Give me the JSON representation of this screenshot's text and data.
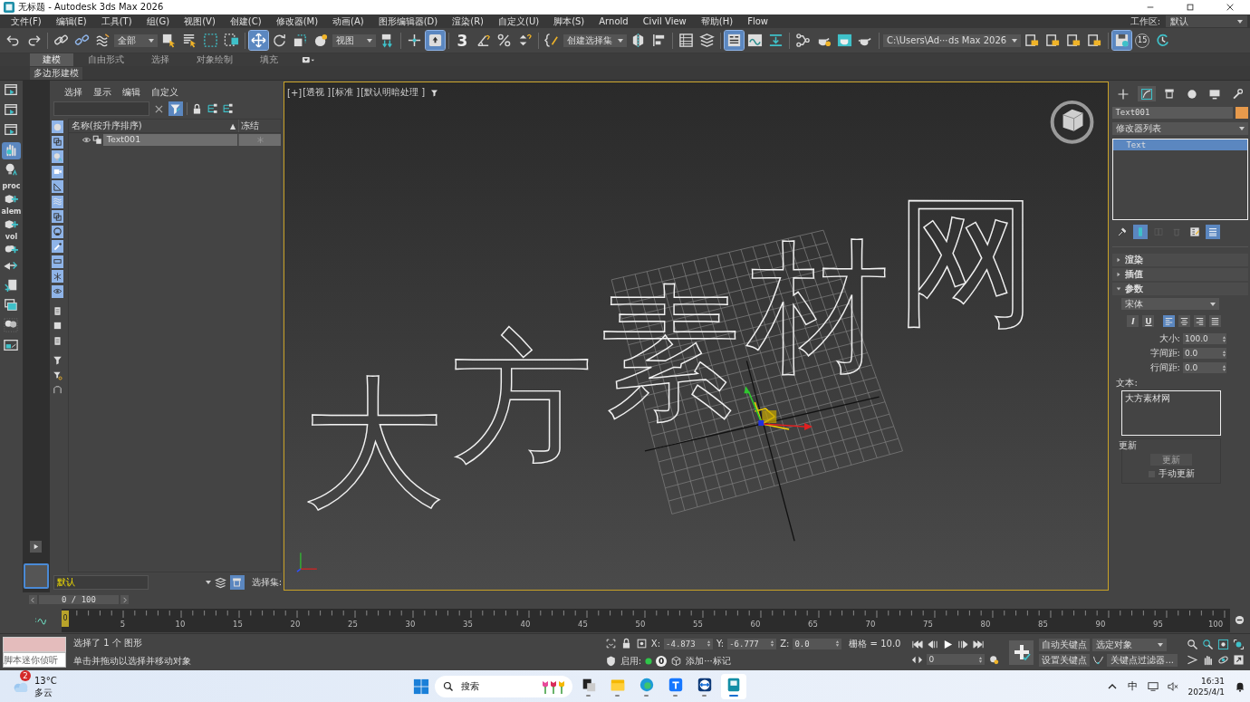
{
  "window": {
    "title": "无标题 - Autodesk 3ds Max 2026"
  },
  "menu": [
    "文件(F)",
    "编辑(E)",
    "工具(T)",
    "组(G)",
    "视图(V)",
    "创建(C)",
    "修改器(M)",
    "动画(A)",
    "图形编辑器(D)",
    "渲染(R)",
    "自定义(U)",
    "脚本(S)",
    "Arnold",
    "Civil View",
    "帮助(H)",
    "Flow"
  ],
  "workspace": {
    "label": "工作区:",
    "value": "默认"
  },
  "toolbar": [
    {
      "kind": "button",
      "selected": false
    },
    {
      "kind": "button",
      "selected": false
    },
    {
      "kind": "separator"
    },
    {
      "kind": "button",
      "selected": false
    },
    {
      "kind": "button",
      "selected": false
    },
    {
      "kind": "button",
      "selected": false
    },
    {
      "kind": "dropdown",
      "value": "全部"
    },
    {
      "kind": "button",
      "selected": false
    },
    {
      "kind": "button",
      "selected": false
    },
    {
      "kind": "button",
      "selected": false
    },
    {
      "kind": "button",
      "selected": false
    },
    {
      "kind": "separator"
    },
    {
      "kind": "button",
      "selected": true
    },
    {
      "kind": "button",
      "selected": false
    },
    {
      "kind": "button",
      "selected": false
    },
    {
      "kind": "button",
      "selected": false
    },
    {
      "kind": "dropdown",
      "value": "视图"
    },
    {
      "kind": "button",
      "selected": false
    },
    {
      "kind": "separator"
    },
    {
      "kind": "button",
      "selected": false
    },
    {
      "kind": "button",
      "selected": true
    },
    {
      "kind": "separator"
    },
    {
      "kind": "button",
      "selected": false,
      "label": "3"
    },
    {
      "kind": "button",
      "selected": false
    },
    {
      "kind": "button",
      "selected": false
    },
    {
      "kind": "button",
      "selected": false
    },
    {
      "kind": "separator"
    },
    {
      "kind": "button",
      "selected": false
    },
    {
      "kind": "dropdown",
      "value": "创建选择集"
    },
    {
      "kind": "button",
      "selected": false
    },
    {
      "kind": "button",
      "selected": false
    },
    {
      "kind": "separator"
    },
    {
      "kind": "button",
      "selected": false
    },
    {
      "kind": "button",
      "selected": false
    },
    {
      "kind": "separator"
    },
    {
      "kind": "button",
      "selected": true
    },
    {
      "kind": "button",
      "selected": false
    },
    {
      "kind": "button",
      "selected": false
    },
    {
      "kind": "separator"
    },
    {
      "kind": "button",
      "selected": false
    },
    {
      "kind": "button",
      "selected": false
    },
    {
      "kind": "button",
      "selected": false
    },
    {
      "kind": "button",
      "selected": false
    },
    {
      "kind": "separator"
    },
    {
      "kind": "dropdown",
      "value": "C:\\Users\\Ad⋯ds Max 2026"
    },
    {
      "kind": "button",
      "selected": false
    },
    {
      "kind": "button",
      "selected": false
    },
    {
      "kind": "button",
      "selected": false
    },
    {
      "kind": "button",
      "selected": false
    },
    {
      "kind": "separator"
    },
    {
      "kind": "button",
      "selected": true
    },
    {
      "kind": "button",
      "selected": false,
      "label": "15"
    },
    {
      "kind": "button",
      "selected": false
    }
  ],
  "ribbon": {
    "tabs": [
      {
        "label": "建模",
        "selected": true
      },
      {
        "label": "自由形式",
        "selected": false
      },
      {
        "label": "选择",
        "selected": false
      },
      {
        "label": "对象绘制",
        "selected": false
      },
      {
        "label": "填充",
        "selected": false
      }
    ],
    "panel": "多边形建模"
  },
  "left_toolbar": [
    {
      "selected": false
    },
    {
      "selected": false
    },
    {
      "selected": false
    },
    {
      "selected": true
    },
    {
      "selected": false
    },
    {
      "selected": false,
      "label": "proc"
    },
    {
      "selected": false,
      "label": "alem"
    },
    {
      "selected": false,
      "label": "vol"
    },
    {
      "selected": false
    },
    {
      "selected": false
    },
    {
      "selected": false
    },
    {
      "selected": false
    },
    {
      "selected": false
    }
  ],
  "explorer": {
    "menu": [
      "选择",
      "显示",
      "编辑",
      "自定义"
    ],
    "filter_on": true,
    "columns": [
      "名称(按升序排序)",
      "冻结"
    ],
    "sort_indicator": "▲",
    "rows": [
      {
        "name": "Text001",
        "selected": true
      }
    ],
    "filters": [
      {
        "selected": true
      },
      {
        "selected": true
      },
      {
        "selected": true
      },
      {
        "selected": true
      },
      {
        "selected": true
      },
      {
        "selected": true
      },
      {
        "selected": true
      },
      {
        "selected": true
      },
      {
        "selected": true
      },
      {
        "selected": true
      },
      {
        "selected": true
      },
      {
        "selected": true
      },
      {
        "selected": false
      },
      {
        "selected": false
      },
      {
        "selected": false
      },
      {
        "selected": false
      },
      {
        "selected": false
      },
      {
        "selected": false
      }
    ],
    "layer": "默认",
    "selection_set_label": "选择集:"
  },
  "viewport": {
    "labels": [
      "[+]",
      "[透视 ]",
      "[标准 ]",
      "[默认明暗处理 ]"
    ],
    "scene_text": "大方素材网",
    "active": true
  },
  "command_panel": {
    "tabs": [
      {
        "selected": false
      },
      {
        "selected": true
      },
      {
        "selected": false
      },
      {
        "selected": false
      },
      {
        "selected": false
      },
      {
        "selected": false
      }
    ],
    "object_name": "Text001",
    "modifier_list": "修改器列表",
    "stack": [
      {
        "name": "Text",
        "selected": true
      }
    ],
    "stack_tools": [
      {
        "selected": false,
        "disabled": false
      },
      {
        "selected": true,
        "disabled": false
      },
      {
        "selected": false,
        "disabled": true
      },
      {
        "selected": false,
        "disabled": true
      },
      {
        "selected": false,
        "disabled": false
      },
      {
        "selected": true,
        "disabled": false
      }
    ],
    "rollouts": [
      {
        "title": "渲染",
        "expanded": false
      },
      {
        "title": "插值",
        "expanded": false
      },
      {
        "title": "参数",
        "expanded": true
      }
    ],
    "parameters": {
      "font": "宋体",
      "styles": [
        {
          "label": "I",
          "selected": false
        },
        {
          "label": "U",
          "selected": false
        }
      ],
      "align": [
        {
          "selected": true
        },
        {
          "selected": false
        },
        {
          "selected": false
        },
        {
          "selected": false
        }
      ],
      "fields": [
        {
          "label": "大小:",
          "value": "100.0"
        },
        {
          "label": "字间距:",
          "value": "0.0"
        },
        {
          "label": "行间距:",
          "value": "0.0"
        }
      ],
      "text_label": "文本:",
      "text": "大方素材网",
      "update_group": "更新",
      "update_button": {
        "label": "更新",
        "disabled": true
      },
      "manual_update": {
        "label": "手动更新",
        "checked": false
      }
    }
  },
  "timeline": {
    "position": "0 / 100",
    "thumb": "0",
    "labels": [
      "5",
      "10",
      "15",
      "20",
      "25",
      "30",
      "35",
      "40",
      "45",
      "50",
      "55",
      "60",
      "65",
      "70",
      "75",
      "80",
      "85",
      "90",
      "95",
      "100"
    ]
  },
  "status": {
    "listener": "脚本迷你侦听",
    "selection": "选择了 1 个 图形",
    "prompt": "单击并拖动以选择并移动对象",
    "coords": [
      {
        "label": "X:",
        "value": "-4.873"
      },
      {
        "label": "Y:",
        "value": "-6.777"
      },
      {
        "label": "Z:",
        "value": "0.0"
      }
    ],
    "grid": "栅格 = 10.0",
    "enable_label": "启用:",
    "counter": "0",
    "add_tag": "添加⋯标记",
    "frame": "0",
    "auto_key": "自动关键点",
    "set_key": "设置关键点",
    "key_target": "选定对象",
    "key_filters": "关键点过滤器..."
  },
  "taskbar": {
    "weather": {
      "badge": "2",
      "temp": "13°C",
      "desc": "多云"
    },
    "search": "搜索",
    "apps": [
      {
        "selected": false
      },
      {
        "selected": false
      },
      {
        "selected": false
      },
      {
        "selected": false
      },
      {
        "selected": false
      },
      {
        "selected": true
      }
    ],
    "ime": "中",
    "time": "16:31",
    "date": "2025/4/1"
  }
}
